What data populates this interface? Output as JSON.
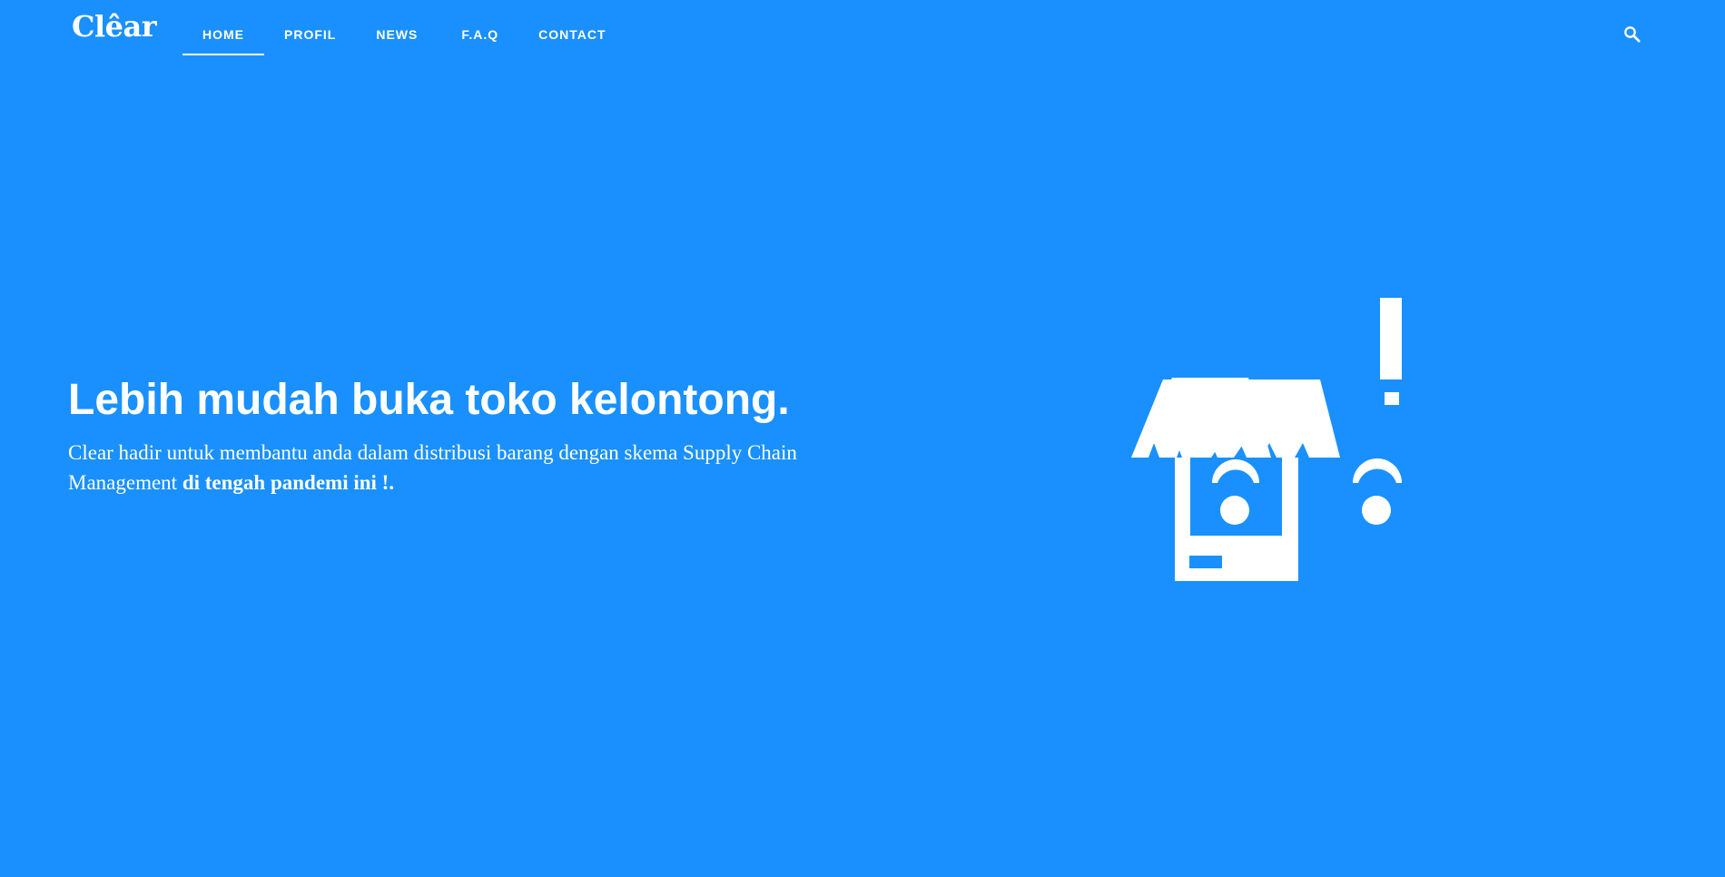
{
  "header": {
    "logo_text": "Clêar",
    "nav": [
      {
        "label": "HOME",
        "active": true
      },
      {
        "label": "PROFIL",
        "active": false
      },
      {
        "label": "NEWS",
        "active": false
      },
      {
        "label": "F.A.Q",
        "active": false
      },
      {
        "label": "CONTACT",
        "active": false
      }
    ],
    "search_icon": "search-icon"
  },
  "hero": {
    "title": "Lebih mudah buka toko kelontong.",
    "desc_part1": "Clear hadir untuk membantu anda dalam distribusi barang dengan skema Supply Chain Management ",
    "desc_bold": "di tengah pandemi ini !.",
    "illustration": "grocery-stall-illustration"
  },
  "colors": {
    "background": "#1a90ff",
    "foreground": "#ffffff"
  }
}
